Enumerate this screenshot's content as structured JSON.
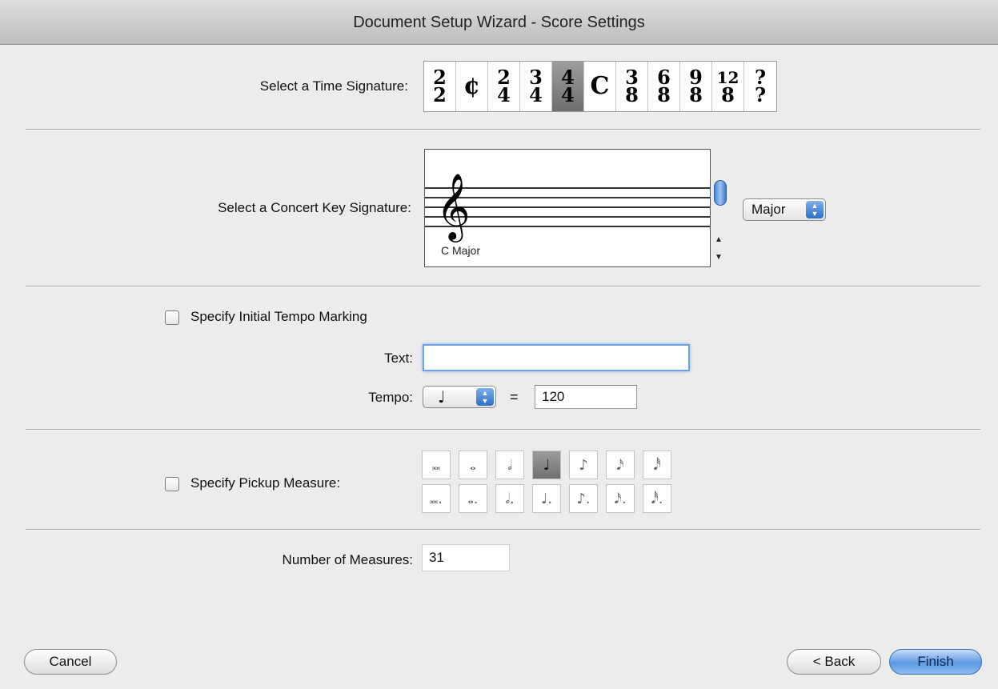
{
  "window": {
    "title": "Document Setup Wizard - Score Settings"
  },
  "time_signature": {
    "label": "Select a Time Signature:",
    "options": [
      {
        "num": "2",
        "den": "2"
      },
      {
        "symbol": "¢"
      },
      {
        "num": "2",
        "den": "4"
      },
      {
        "num": "3",
        "den": "4"
      },
      {
        "num": "4",
        "den": "4"
      },
      {
        "symbol": "C"
      },
      {
        "num": "3",
        "den": "8"
      },
      {
        "num": "6",
        "den": "8"
      },
      {
        "num": "9",
        "den": "8"
      },
      {
        "num": "12",
        "den": "8"
      },
      {
        "num": "?",
        "den": "?"
      }
    ],
    "selected_index": 4
  },
  "key_signature": {
    "label": "Select a Concert Key Signature:",
    "key_name": "C Major",
    "clef_icon": "treble-clef-icon",
    "mode_popup": "Major"
  },
  "tempo": {
    "checkbox_label": "Specify Initial Tempo Marking",
    "checked": false,
    "text_label": "Text:",
    "text_value": "",
    "tempo_label": "Tempo:",
    "note_value": "quarter-note-icon",
    "equals": "=",
    "bpm": "120"
  },
  "pickup": {
    "checkbox_label": "Specify Pickup Measure:",
    "checked": false,
    "rows": [
      [
        "double-whole-note-icon",
        "whole-note-icon",
        "half-note-icon",
        "quarter-note-icon",
        "eighth-note-icon",
        "sixteenth-note-icon",
        "thirty-second-note-icon"
      ],
      [
        "dotted-double-whole-note-icon",
        "dotted-whole-note-icon",
        "dotted-half-note-icon",
        "dotted-quarter-note-icon",
        "dotted-eighth-note-icon",
        "dotted-sixteenth-note-icon",
        "dotted-thirty-second-note-icon"
      ]
    ],
    "selected": {
      "row": 0,
      "col": 3
    }
  },
  "measures": {
    "label": "Number of Measures:",
    "value": "31"
  },
  "buttons": {
    "cancel": "Cancel",
    "back": "< Back",
    "finish": "Finish"
  }
}
